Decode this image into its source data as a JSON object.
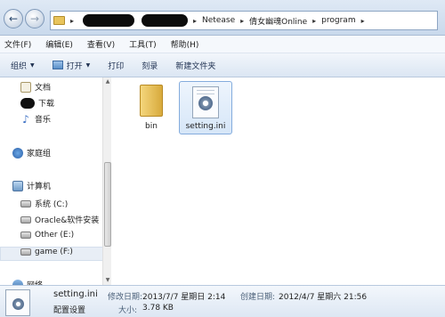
{
  "address": {
    "crumbs": [
      "Netease",
      "倩女幽魂Online",
      "program"
    ]
  },
  "menu": [
    "文件(F)",
    "编辑(E)",
    "查看(V)",
    "工具(T)",
    "帮助(H)"
  ],
  "toolbar": {
    "organize": "组织",
    "open": "打开",
    "print": "打印",
    "burn": "刻录",
    "new_folder": "新建文件夹"
  },
  "nav": {
    "documents": "文档",
    "downloads": "下载",
    "music": "音乐",
    "homegroup": "家庭组",
    "computer": "计算机",
    "drive_c": "系统 (C:)",
    "drive_d": "Oracle&软件安装",
    "drive_e": "Other (E:)",
    "drive_f": "game (F:)",
    "network": "网络"
  },
  "files": [
    {
      "name": "bin",
      "icon": "folder-icon"
    },
    {
      "name": "setting.ini",
      "icon": "ini-file-icon",
      "selected": true
    }
  ],
  "details": {
    "name": "setting.ini",
    "type": "配置设置",
    "modified_label": "修改日期:",
    "modified_value": "2013/7/7 星期日 2:14",
    "created_label": "创建日期:",
    "created_value": "2012/4/7 星期六 21:56",
    "size_label": "大小:",
    "size_value": "3.78 KB"
  }
}
